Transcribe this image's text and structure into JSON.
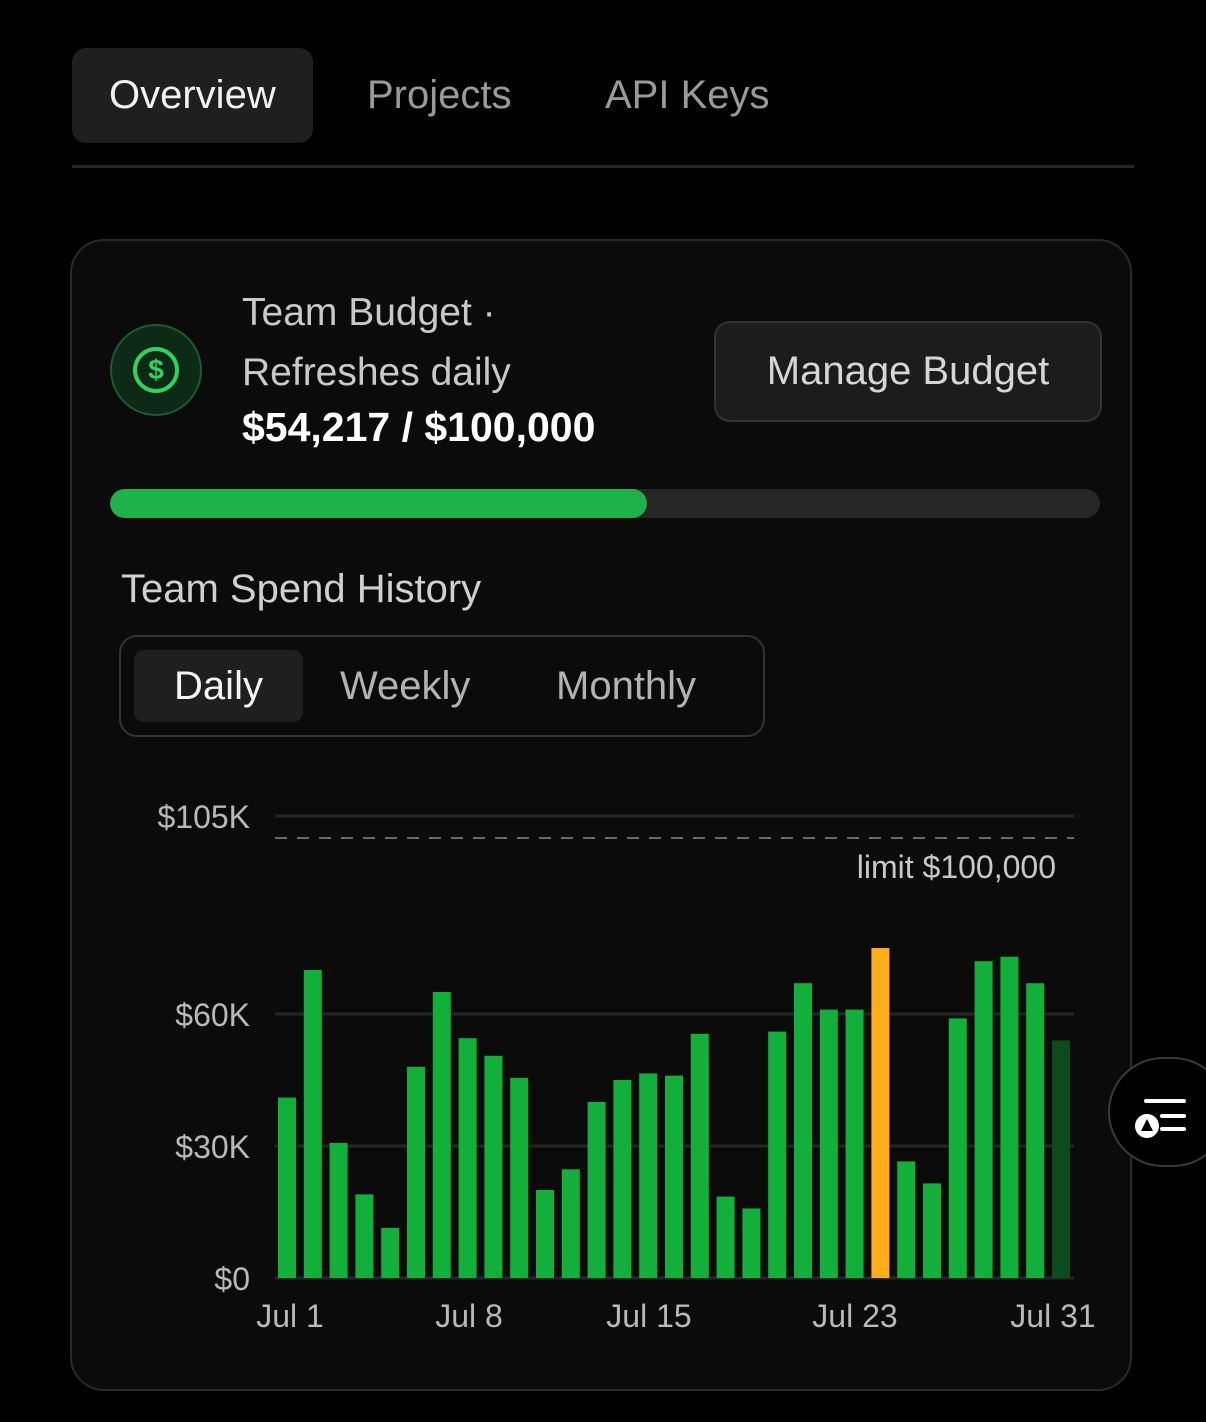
{
  "tabs": [
    {
      "label": "Overview",
      "active": true
    },
    {
      "label": "Projects",
      "active": false
    },
    {
      "label": "API Keys",
      "active": false
    }
  ],
  "budget": {
    "icon": "dollar-icon",
    "title": "Team Budget · Refreshes daily",
    "amount": "$54,217 / $100,000",
    "progress_fraction": 0.54217,
    "manage_label": "Manage Budget"
  },
  "history": {
    "title": "Team Spend History",
    "periods": [
      {
        "label": "Daily",
        "active": true
      },
      {
        "label": "Weekly",
        "active": false
      },
      {
        "label": "Monthly",
        "active": false
      }
    ]
  },
  "colors": {
    "bar": "#12b03b",
    "bar_highlight": "#ffad19",
    "bar_current": "#0d4a1c",
    "progress": "#1db24a"
  },
  "fab_icon": "list-filter-icon",
  "chart_data": {
    "type": "bar",
    "y_tick_labels": [
      "$0",
      "$30K",
      "$60K",
      "$105K"
    ],
    "y_ticks": [
      0,
      30000,
      60000,
      105000
    ],
    "x_tick_labels": [
      "Jul 1",
      "Jul 8",
      "Jul 15",
      "Jul 23",
      "Jul 31"
    ],
    "limit_label": "limit $100,000",
    "limit_value": 100000,
    "ylim": [
      0,
      105000
    ],
    "categories": [
      "Jul 1",
      "Jul 2",
      "Jul 3",
      "Jul 4",
      "Jul 5",
      "Jul 6",
      "Jul 7",
      "Jul 8",
      "Jul 9",
      "Jul 10",
      "Jul 11",
      "Jul 12",
      "Jul 13",
      "Jul 14",
      "Jul 15",
      "Jul 16",
      "Jul 17",
      "Jul 18",
      "Jul 19",
      "Jul 20",
      "Jul 21",
      "Jul 22",
      "Jul 23",
      "Jul 24",
      "Jul 25",
      "Jul 26",
      "Jul 27",
      "Jul 28",
      "Jul 29",
      "Jul 30",
      "Jul 31"
    ],
    "values": [
      41000,
      70000,
      30700,
      19000,
      11400,
      48000,
      65000,
      54500,
      50500,
      45500,
      20000,
      24700,
      40000,
      45000,
      46500,
      46000,
      55500,
      18500,
      15800,
      56000,
      67000,
      61000,
      61000,
      75000,
      26500,
      21500,
      59000,
      72000,
      73000,
      67000,
      54000
    ],
    "highlight_index": 23,
    "current_index": 30,
    "grid": true
  }
}
